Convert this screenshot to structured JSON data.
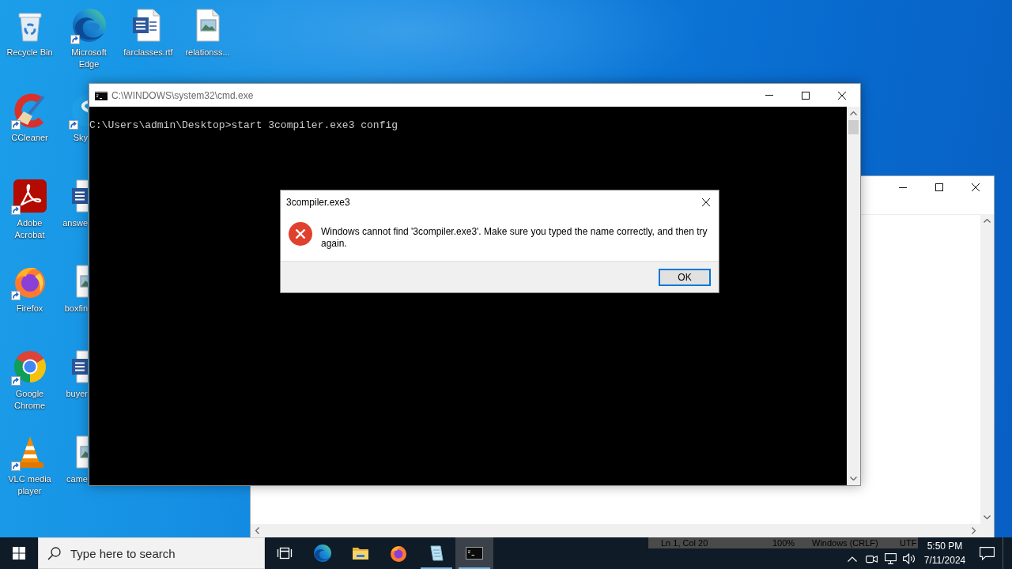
{
  "desktop": {
    "columns": [
      {
        "icons": [
          {
            "label": "Recycle Bin",
            "kind": "recycle-bin",
            "shortcut": false
          },
          {
            "label": "CCleaner",
            "kind": "ccleaner",
            "shortcut": true
          },
          {
            "label": "Adobe Acrobat",
            "kind": "acrobat",
            "shortcut": true
          },
          {
            "label": "Firefox",
            "kind": "firefox",
            "shortcut": true
          },
          {
            "label": "Google Chrome",
            "kind": "chrome",
            "shortcut": true
          },
          {
            "label": "VLC media player",
            "kind": "vlc",
            "shortcut": true
          }
        ]
      },
      {
        "icons": [
          {
            "label": "Microsoft Edge",
            "kind": "edge",
            "shortcut": true
          },
          {
            "label": "Sky",
            "kind": "skype",
            "shortcut": true
          },
          {
            "label": "answe",
            "kind": "word-doc",
            "shortcut": false
          },
          {
            "label": "boxfin",
            "kind": "image-doc",
            "shortcut": false
          },
          {
            "label": "buyer",
            "kind": "word-doc",
            "shortcut": false
          },
          {
            "label": "came",
            "kind": "image-doc",
            "shortcut": false
          }
        ]
      },
      {
        "icons": [
          {
            "label": "farclasses.rtf",
            "kind": "word-doc",
            "shortcut": false
          }
        ]
      },
      {
        "icons": [
          {
            "label": "relationss...",
            "kind": "image-doc",
            "shortcut": false
          }
        ]
      }
    ]
  },
  "notepad_window": {
    "status_bar": [
      "Ln 1, Col 20",
      "100%",
      "Windows (CRLF)",
      "UTF"
    ]
  },
  "cmd_window": {
    "title": "C:\\WINDOWS\\system32\\cmd.exe",
    "lines": [
      "C:\\Users\\admin\\Desktop>start 3compiler.exe3 config"
    ]
  },
  "dialog": {
    "title": "3compiler.exe3",
    "kind": "error",
    "message": "Windows cannot find '3compiler.exe3'. Make sure you typed the name correctly, and then try again.",
    "buttons": [
      {
        "label": "OK",
        "default": true
      }
    ]
  },
  "taskbar": {
    "search": {
      "placeholder": "Type here to search"
    },
    "apps": [
      {
        "kind": "task-view",
        "running": false,
        "active": false
      },
      {
        "kind": "edge",
        "running": false,
        "active": false
      },
      {
        "kind": "explorer",
        "running": false,
        "active": false
      },
      {
        "kind": "firefox",
        "running": false,
        "active": false
      },
      {
        "kind": "notepad",
        "running": true,
        "active": false
      },
      {
        "kind": "cmd",
        "running": true,
        "active": true
      }
    ],
    "clock": {
      "time": "5:50 PM",
      "date": "7/11/2024"
    }
  }
}
